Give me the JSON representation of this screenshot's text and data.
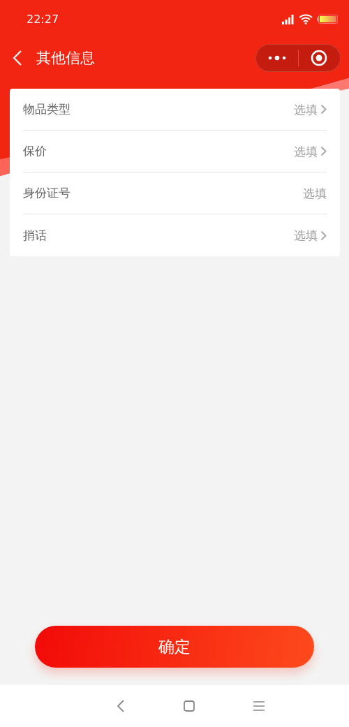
{
  "status_bar": {
    "time": "22:27"
  },
  "nav_bar": {
    "title": "其他信息"
  },
  "form_rows": [
    {
      "label": "物品类型",
      "placeholder": "选填",
      "kind": "select"
    },
    {
      "label": "保价",
      "placeholder": "选填",
      "kind": "select"
    },
    {
      "label": "身份证号",
      "placeholder": "选填",
      "kind": "input"
    },
    {
      "label": "捎话",
      "placeholder": "选填",
      "kind": "select"
    }
  ],
  "confirm_button": {
    "label": "确定"
  }
}
